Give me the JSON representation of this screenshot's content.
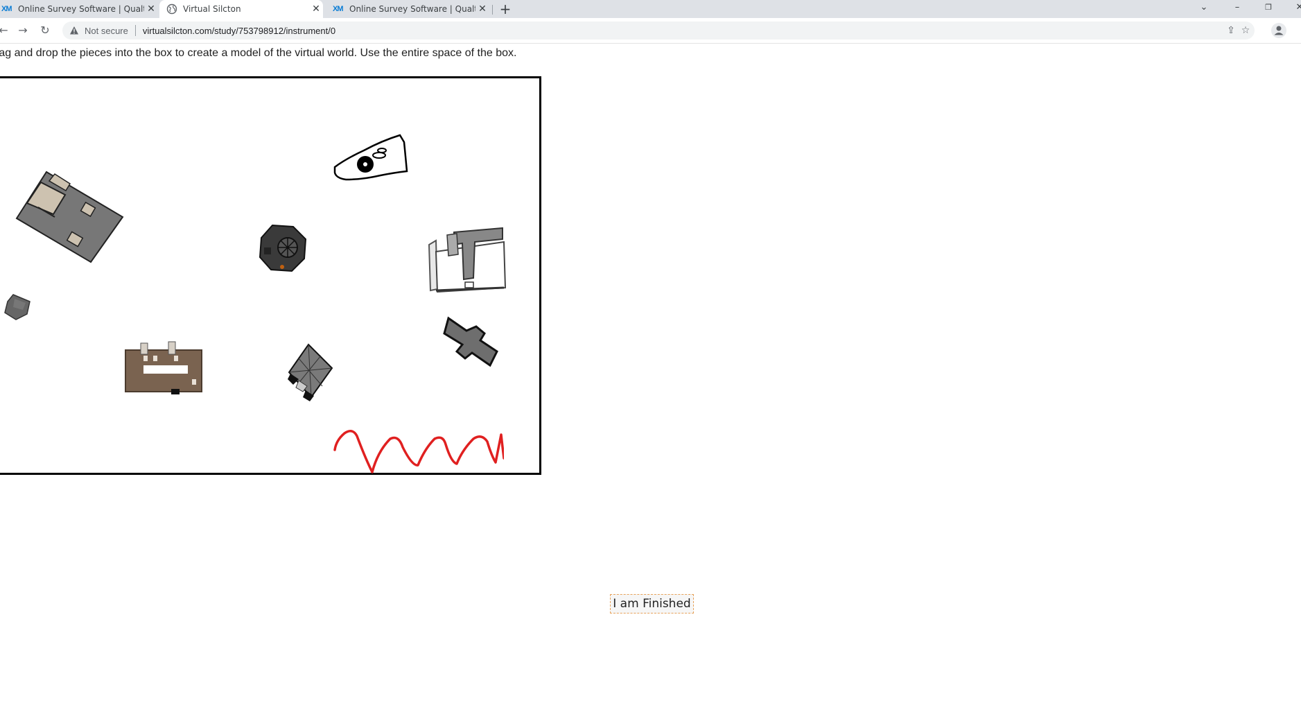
{
  "browser": {
    "tabs": [
      {
        "favicon": "XM",
        "title": "Online Survey Software | Qualtrics",
        "active": false
      },
      {
        "favicon": "globe-icon",
        "title": "Virtual Silcton",
        "active": true
      },
      {
        "favicon": "XM",
        "title": "Online Survey Software | Qualtrics",
        "active": false
      }
    ],
    "close_glyph": "✕",
    "new_tab_glyph": "+",
    "address": {
      "security_label": "Not secure",
      "url": "virtualsilcton.com/study/753798912/instrument/0"
    },
    "colors": {
      "tab_strip": "#dee1e6",
      "omnibox": "#f1f3f4"
    }
  },
  "page": {
    "instructions": "rag and drop the pieces into the box to create a model of the virtual world. Use the entire space of the box.",
    "finish_button": "I am Finished",
    "pieces": [
      "building-gray-rect-piece",
      "building-sketch-piece",
      "building-dark-octagon-piece",
      "building-white-complex-piece",
      "building-small-gray-piece",
      "building-cross-piece",
      "building-brown-piece",
      "building-diamond-piece",
      "red-zigzag-piece"
    ],
    "colors": {
      "accent_red": "#e02020",
      "brown": "#7a6350",
      "button_border": "#e7a25a"
    }
  }
}
